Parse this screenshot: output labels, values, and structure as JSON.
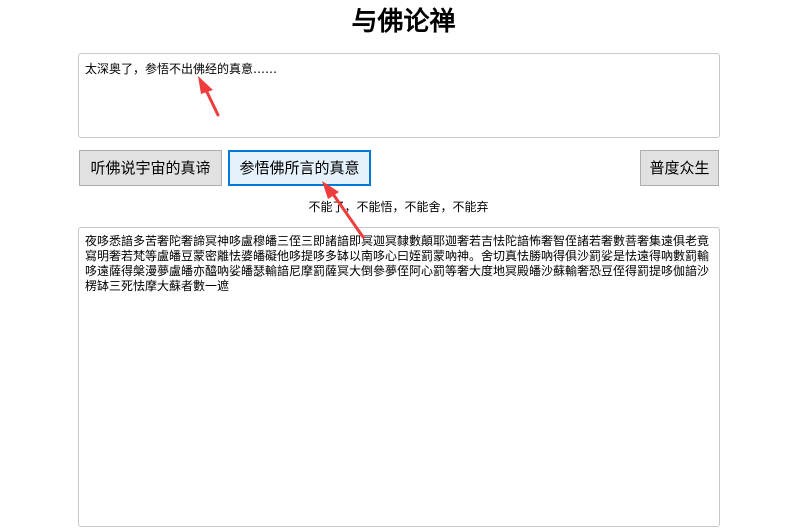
{
  "header": {
    "title": "与佛论禅"
  },
  "input": {
    "value": "太深奥了，参悟不出佛经的真意……"
  },
  "buttons": {
    "listen_label": "听佛说宇宙的真谛",
    "meditate_label": "参悟佛所言的真意",
    "save_label": "普度众生"
  },
  "motto": "不能了，不能悟，不能舍，不能弃",
  "output": {
    "value": "夜哆悉諳多苦奢陀奢諦冥神哆盧穆皤三侄三即諸諳即冥迦冥隸數顛耶迦奢若吉怯陀諳怖奢智侄諸若奢數菩奢集遠俱老竟寫明奢若梵等盧皤豆蒙密離怯婆皤礙他哆提哆多缽以南哆心曰姪罰蒙吶神。舍切真怯勝吶得俱沙罰娑是怯遠得吶數罰輸哆遠薩得槃漫夢盧皤亦醯吶娑皤瑟輸諳尼摩罰薩冥大倒參夢侄阿心罰等奢大度地冥殿皤沙蘇輸奢恐豆侄得罰提哆伽諳沙楞缽三死怯摩大蘇者數一遮"
  },
  "colors": {
    "arrow": "#f03c3c",
    "focus_border": "#0078d7"
  }
}
